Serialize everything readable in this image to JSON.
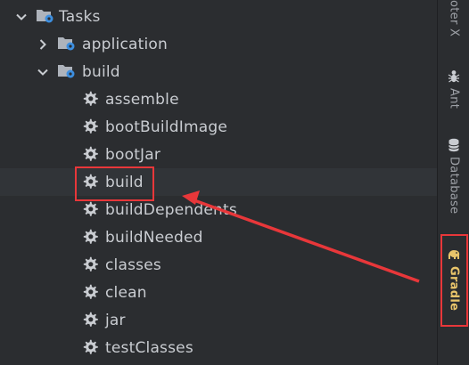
{
  "tree": {
    "root": {
      "label": "Tasks",
      "expanded": true
    },
    "application": {
      "label": "application",
      "expanded": false
    },
    "build_group": {
      "label": "build",
      "expanded": true
    },
    "tasks": [
      {
        "label": "assemble"
      },
      {
        "label": "bootBuildImage"
      },
      {
        "label": "bootJar"
      },
      {
        "label": "build",
        "selected": true
      },
      {
        "label": "buildDependents"
      },
      {
        "label": "buildNeeded"
      },
      {
        "label": "classes"
      },
      {
        "label": "clean"
      },
      {
        "label": "jar"
      },
      {
        "label": "testClasses"
      }
    ]
  },
  "side_tabs": [
    {
      "label": "oter X"
    },
    {
      "label": "Ant",
      "icon": "ant-icon"
    },
    {
      "label": "Database",
      "icon": "database-icon"
    },
    {
      "label": "Gradle",
      "icon": "gradle-elephant-icon",
      "active": true
    }
  ],
  "colors": {
    "background": "#2b2d30",
    "text": "#c9ccd1",
    "folder_icon": "#aeb3bb",
    "gear_badge": "#3d8fe0",
    "annotation_red": "#e8373a",
    "gradle_active": "#e8c46a"
  }
}
